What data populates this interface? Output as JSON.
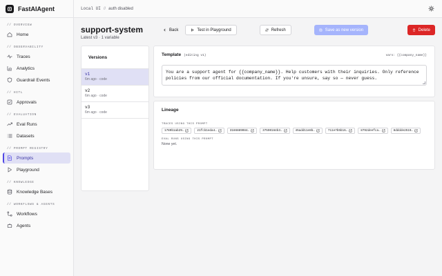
{
  "app": {
    "name": "FastAIAgent"
  },
  "topbar": {
    "env": "Local UI",
    "separator": "//",
    "auth": "auth disabled"
  },
  "sidebar": {
    "sections": [
      {
        "label": "// OVERVIEW",
        "items": [
          {
            "label": "Home",
            "icon": "home-icon"
          }
        ]
      },
      {
        "label": "// OBSERVABILITY",
        "items": [
          {
            "label": "Traces",
            "icon": "pulse-icon"
          },
          {
            "label": "Analytics",
            "icon": "bar-chart-icon"
          },
          {
            "label": "Guardrail Events",
            "icon": "shield-icon"
          }
        ]
      },
      {
        "label": "// HITL",
        "items": [
          {
            "label": "Approvals",
            "icon": "checkbox-icon"
          }
        ]
      },
      {
        "label": "// EVALUATION",
        "items": [
          {
            "label": "Eval Runs",
            "icon": "trending-icon"
          },
          {
            "label": "Datasets",
            "icon": "list-icon"
          }
        ]
      },
      {
        "label": "// PROMPT REGISTRY",
        "items": [
          {
            "label": "Prompts",
            "icon": "file-text-icon",
            "active": true
          },
          {
            "label": "Playground",
            "icon": "play-icon"
          }
        ]
      },
      {
        "label": "// KNOWLEDGE",
        "items": [
          {
            "label": "Knowledge Bases",
            "icon": "database-icon"
          }
        ]
      },
      {
        "label": "// WORKFLOWS & AGENTS",
        "items": [
          {
            "label": "Workflows",
            "icon": "workflow-icon"
          },
          {
            "label": "Agents",
            "icon": "bot-icon"
          }
        ]
      }
    ]
  },
  "page": {
    "title": "support-system",
    "subtitle": "Latest v3 · 1 variable"
  },
  "actions": {
    "back": "Back",
    "test": "Test in Playground",
    "refresh": "Refresh",
    "save": "Save as new version",
    "delete": "Delete"
  },
  "versions": {
    "title": "Versions",
    "items": [
      {
        "name": "v1",
        "meta": "6m ago · code",
        "selected": true
      },
      {
        "name": "v2",
        "meta": "6m ago · code"
      },
      {
        "name": "v3",
        "meta": "6m ago · code"
      }
    ]
  },
  "template": {
    "title": "Template",
    "note": "(editing v1)",
    "vars": "vars: {{company_name}}",
    "text": "You are a support agent for {{company_name}}. Help customers with their inquiries. Only reference policies from our official documentation. If you're unsure, say so — never guess."
  },
  "lineage": {
    "title": "Lineage",
    "traces_label": "TRACES USING THIS PROMPT",
    "traces": [
      "1789b1ab29…",
      "21fcb1eda4…",
      "3166889084…",
      "37590164b3…",
      "45add11e8b…",
      "711e7b5b16…",
      "8792deefca…",
      "8dddde2519…"
    ],
    "evals_label": "EVAL RUNS USING THIS PROMPT",
    "evals_empty": "None yet."
  }
}
